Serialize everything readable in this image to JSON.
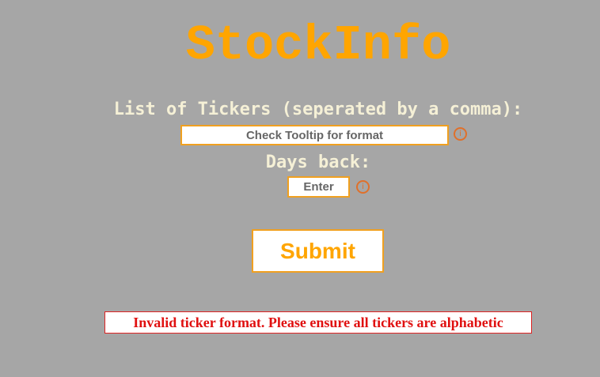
{
  "app": {
    "title": "StockInfo"
  },
  "form": {
    "tickers_label": "List of Tickers (seperated by a comma):",
    "tickers_placeholder": "Check Tooltip for format",
    "tickers_value": "",
    "days_label": "Days back:",
    "days_placeholder": "Enter",
    "days_value": "",
    "submit_label": "Submit"
  },
  "icons": {
    "tickers_info": "info-icon",
    "days_info": "info-icon"
  },
  "error": {
    "message": "Invalid ticker format. Please ensure all tickers are alphabetic"
  },
  "colors": {
    "background": "#a6a6a6",
    "accent": "#ffa500",
    "label": "#f5f0d6",
    "info_icon": "#e0702a",
    "error": "#e01010"
  }
}
